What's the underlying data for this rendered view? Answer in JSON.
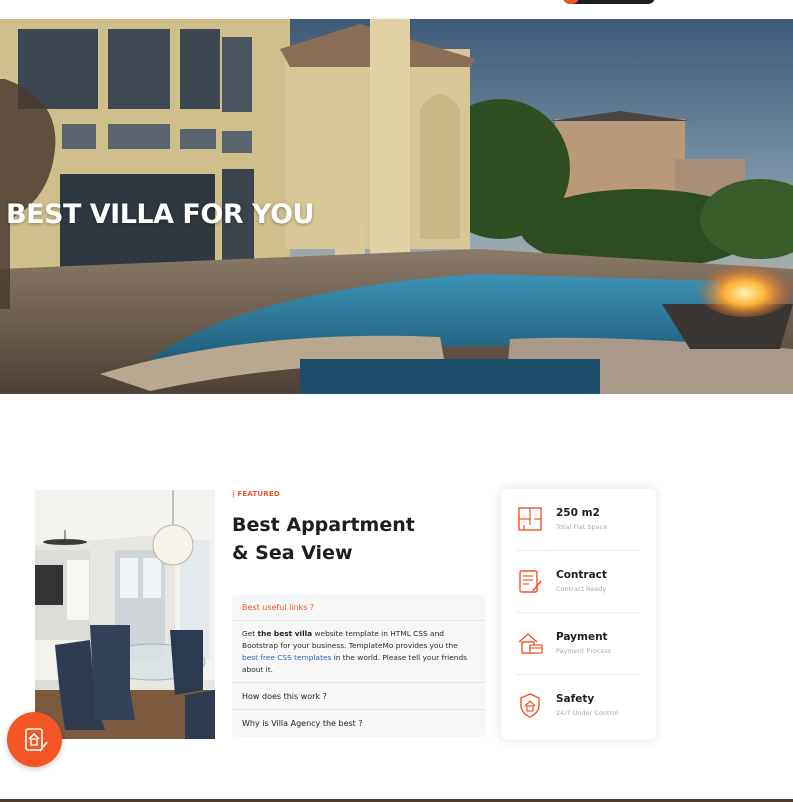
{
  "hero": {
    "title": "BEST VILLA FOR YOU"
  },
  "featured": {
    "label": "| FEATURED",
    "title_line1": "Best Appartment",
    "title_line2": "& Sea View",
    "accordion": {
      "open_title": "Best useful links ?",
      "body_prefix": "Get ",
      "body_bold": "the best villa",
      "body_mid": " website template in HTML CSS and Bootstrap for your business. TemplateMo provides you the ",
      "body_link": "best free CSS templates",
      "body_suffix": " in the world. Please tell your friends about it.",
      "items": [
        "How does this work ?",
        "Why is Villa Agency the best ?"
      ]
    }
  },
  "info": [
    {
      "icon": "floor-plan-icon",
      "value": "250 m2",
      "label": "Total Flat Space"
    },
    {
      "icon": "contract-icon",
      "value": "Contract",
      "label": "Contract Ready"
    },
    {
      "icon": "payment-icon",
      "value": "Payment",
      "label": "Payment Process"
    },
    {
      "icon": "safety-icon",
      "value": "Safety",
      "label": "24/7 Under Control"
    }
  ],
  "colors": {
    "accent": "#f35525",
    "text_dark": "#1e1e1e",
    "muted": "#aaaaaa",
    "link": "#2b63c6"
  }
}
